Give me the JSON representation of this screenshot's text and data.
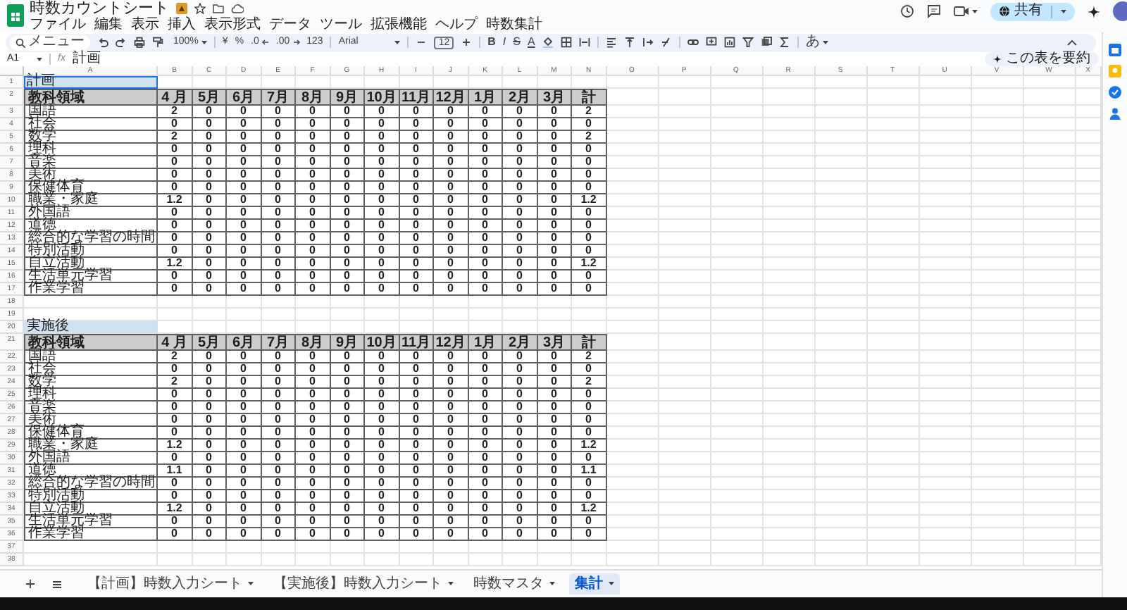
{
  "document": {
    "title": "時数カウントシート"
  },
  "menu": [
    "ファイル",
    "編集",
    "表示",
    "挿入",
    "表示形式",
    "データ",
    "ツール",
    "拡張機能",
    "ヘルプ",
    "時数集計"
  ],
  "share_button": {
    "label": "共有"
  },
  "toolbar": {
    "search": "メニュー",
    "zoom": "100%",
    "currency": "¥",
    "percent": "%",
    "decimal_decrease": ".0",
    "decimal_increase": ".00",
    "number_formats": "123",
    "font": "Arial",
    "font_size": "12",
    "text_formats": [
      "B",
      "I",
      "S",
      "A"
    ],
    "input_tools": "あ"
  },
  "formula_bar": {
    "cell": "A1",
    "function_label": "fx",
    "value": "計画"
  },
  "summarize_button": "この表を要約",
  "column_headers": [
    "A",
    "B",
    "C",
    "D",
    "E",
    "F",
    "G",
    "H",
    "I",
    "J",
    "K",
    "L",
    "M",
    "N",
    "O",
    "P",
    "Q",
    "R",
    "S",
    "T",
    "U",
    "V",
    "W",
    "X"
  ],
  "row_numbers": [
    "1",
    "2",
    "3",
    "4",
    "5",
    "6",
    "7",
    "8",
    "9",
    "10",
    "11",
    "12",
    "13",
    "14",
    "15",
    "16",
    "17",
    "18",
    "19",
    "20",
    "21",
    "22",
    "23",
    "24",
    "25",
    "26",
    "27",
    "28",
    "29",
    "30",
    "31",
    "32",
    "33",
    "34",
    "35",
    "36",
    "37",
    "38"
  ],
  "sections": [
    {
      "title": "計画",
      "selected": true,
      "header": [
        "教科領域",
        "4 月",
        "5月",
        "6月",
        "7月",
        "8月",
        "9月",
        "10月",
        "11月",
        "12月",
        "1月",
        "2月",
        "3月",
        "計"
      ],
      "rows": [
        [
          "国語",
          "2",
          "0",
          "0",
          "0",
          "0",
          "0",
          "0",
          "0",
          "0",
          "0",
          "0",
          "0",
          "2"
        ],
        [
          "社会",
          "0",
          "0",
          "0",
          "0",
          "0",
          "0",
          "0",
          "0",
          "0",
          "0",
          "0",
          "0",
          "0"
        ],
        [
          "数学",
          "2",
          "0",
          "0",
          "0",
          "0",
          "0",
          "0",
          "0",
          "0",
          "0",
          "0",
          "0",
          "2"
        ],
        [
          "理科",
          "0",
          "0",
          "0",
          "0",
          "0",
          "0",
          "0",
          "0",
          "0",
          "0",
          "0",
          "0",
          "0"
        ],
        [
          "音楽",
          "0",
          "0",
          "0",
          "0",
          "0",
          "0",
          "0",
          "0",
          "0",
          "0",
          "0",
          "0",
          "0"
        ],
        [
          "美術",
          "0",
          "0",
          "0",
          "0",
          "0",
          "0",
          "0",
          "0",
          "0",
          "0",
          "0",
          "0",
          "0"
        ],
        [
          "保健体育",
          "0",
          "0",
          "0",
          "0",
          "0",
          "0",
          "0",
          "0",
          "0",
          "0",
          "0",
          "0",
          "0"
        ],
        [
          "職業・家庭",
          "1.2",
          "0",
          "0",
          "0",
          "0",
          "0",
          "0",
          "0",
          "0",
          "0",
          "0",
          "0",
          "1.2"
        ],
        [
          "外国語",
          "0",
          "0",
          "0",
          "0",
          "0",
          "0",
          "0",
          "0",
          "0",
          "0",
          "0",
          "0",
          "0"
        ],
        [
          "道徳",
          "0",
          "0",
          "0",
          "0",
          "0",
          "0",
          "0",
          "0",
          "0",
          "0",
          "0",
          "0",
          "0"
        ],
        [
          "総合的な学習の時間",
          "0",
          "0",
          "0",
          "0",
          "0",
          "0",
          "0",
          "0",
          "0",
          "0",
          "0",
          "0",
          "0"
        ],
        [
          "特別活動",
          "0",
          "0",
          "0",
          "0",
          "0",
          "0",
          "0",
          "0",
          "0",
          "0",
          "0",
          "0",
          "0"
        ],
        [
          "自立活動",
          "1.2",
          "0",
          "0",
          "0",
          "0",
          "0",
          "0",
          "0",
          "0",
          "0",
          "0",
          "0",
          "1.2"
        ],
        [
          "生活単元学習",
          "0",
          "0",
          "0",
          "0",
          "0",
          "0",
          "0",
          "0",
          "0",
          "0",
          "0",
          "0",
          "0"
        ],
        [
          "作業学習",
          "0",
          "0",
          "0",
          "0",
          "0",
          "0",
          "0",
          "0",
          "0",
          "0",
          "0",
          "0",
          "0"
        ]
      ]
    },
    {
      "title": "実施後",
      "selected": false,
      "header": [
        "教科領域",
        "4 月",
        "5月",
        "6月",
        "7月",
        "8月",
        "9月",
        "10月",
        "11月",
        "12月",
        "1月",
        "2月",
        "3月",
        "計"
      ],
      "rows": [
        [
          "国語",
          "2",
          "0",
          "0",
          "0",
          "0",
          "0",
          "0",
          "0",
          "0",
          "0",
          "0",
          "0",
          "2"
        ],
        [
          "社会",
          "0",
          "0",
          "0",
          "0",
          "0",
          "0",
          "0",
          "0",
          "0",
          "0",
          "0",
          "0",
          "0"
        ],
        [
          "数学",
          "2",
          "0",
          "0",
          "0",
          "0",
          "0",
          "0",
          "0",
          "0",
          "0",
          "0",
          "0",
          "2"
        ],
        [
          "理科",
          "0",
          "0",
          "0",
          "0",
          "0",
          "0",
          "0",
          "0",
          "0",
          "0",
          "0",
          "0",
          "0"
        ],
        [
          "音楽",
          "0",
          "0",
          "0",
          "0",
          "0",
          "0",
          "0",
          "0",
          "0",
          "0",
          "0",
          "0",
          "0"
        ],
        [
          "美術",
          "0",
          "0",
          "0",
          "0",
          "0",
          "0",
          "0",
          "0",
          "0",
          "0",
          "0",
          "0",
          "0"
        ],
        [
          "保健体育",
          "0",
          "0",
          "0",
          "0",
          "0",
          "0",
          "0",
          "0",
          "0",
          "0",
          "0",
          "0",
          "0"
        ],
        [
          "職業・家庭",
          "1.2",
          "0",
          "0",
          "0",
          "0",
          "0",
          "0",
          "0",
          "0",
          "0",
          "0",
          "0",
          "1.2"
        ],
        [
          "外国語",
          "0",
          "0",
          "0",
          "0",
          "0",
          "0",
          "0",
          "0",
          "0",
          "0",
          "0",
          "0",
          "0"
        ],
        [
          "道徳",
          "1.1",
          "0",
          "0",
          "0",
          "0",
          "0",
          "0",
          "0",
          "0",
          "0",
          "0",
          "0",
          "1.1"
        ],
        [
          "総合的な学習の時間",
          "0",
          "0",
          "0",
          "0",
          "0",
          "0",
          "0",
          "0",
          "0",
          "0",
          "0",
          "0",
          "0"
        ],
        [
          "特別活動",
          "0",
          "0",
          "0",
          "0",
          "0",
          "0",
          "0",
          "0",
          "0",
          "0",
          "0",
          "0",
          "0"
        ],
        [
          "自立活動",
          "1.2",
          "0",
          "0",
          "0",
          "0",
          "0",
          "0",
          "0",
          "0",
          "0",
          "0",
          "0",
          "1.2"
        ],
        [
          "生活単元学習",
          "0",
          "0",
          "0",
          "0",
          "0",
          "0",
          "0",
          "0",
          "0",
          "0",
          "0",
          "0",
          "0"
        ],
        [
          "作業学習",
          "0",
          "0",
          "0",
          "0",
          "0",
          "0",
          "0",
          "0",
          "0",
          "0",
          "0",
          "0",
          "0"
        ]
      ]
    }
  ],
  "sheet_tabs": [
    {
      "label": "【計画】時数入力シート",
      "selected": false
    },
    {
      "label": "【実施後】時数入力シート",
      "selected": false
    },
    {
      "label": "時数マスタ",
      "selected": false
    },
    {
      "label": "集計",
      "selected": true
    }
  ]
}
